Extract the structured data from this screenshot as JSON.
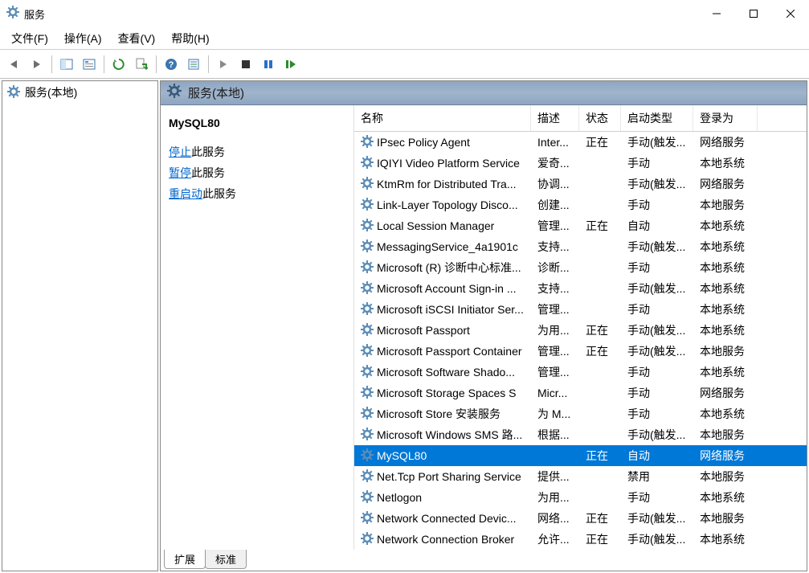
{
  "window": {
    "title": "服务"
  },
  "menu": {
    "file": "文件(F)",
    "action": "操作(A)",
    "view": "查看(V)",
    "help": "帮助(H)"
  },
  "tree": {
    "root": "服务(本地)"
  },
  "pane_header": "服务(本地)",
  "detail": {
    "selected_name": "MySQL80",
    "stop": {
      "link": "停止",
      "suffix": "此服务"
    },
    "pause": {
      "link": "暂停",
      "suffix": "此服务"
    },
    "restart": {
      "link": "重启动",
      "suffix": "此服务"
    }
  },
  "columns": {
    "name": "名称",
    "desc": "描述",
    "status": "状态",
    "startup": "启动类型",
    "logon": "登录为"
  },
  "services": [
    {
      "name": "IPsec Policy Agent",
      "desc": "Inter...",
      "status": "正在",
      "startup": "手动(触发...",
      "logon": "网络服务"
    },
    {
      "name": "IQIYI Video Platform Service",
      "desc": "爱奇...",
      "status": "",
      "startup": "手动",
      "logon": "本地系统"
    },
    {
      "name": "KtmRm for Distributed Tra...",
      "desc": "协调...",
      "status": "",
      "startup": "手动(触发...",
      "logon": "网络服务"
    },
    {
      "name": "Link-Layer Topology Disco...",
      "desc": "创建...",
      "status": "",
      "startup": "手动",
      "logon": "本地服务"
    },
    {
      "name": "Local Session Manager",
      "desc": "管理...",
      "status": "正在",
      "startup": "自动",
      "logon": "本地系统"
    },
    {
      "name": "MessagingService_4a1901c",
      "desc": "支持...",
      "status": "",
      "startup": "手动(触发...",
      "logon": "本地系统"
    },
    {
      "name": "Microsoft (R) 诊断中心标准...",
      "desc": "诊断...",
      "status": "",
      "startup": "手动",
      "logon": "本地系统"
    },
    {
      "name": "Microsoft Account Sign-in ...",
      "desc": "支持...",
      "status": "",
      "startup": "手动(触发...",
      "logon": "本地系统"
    },
    {
      "name": "Microsoft iSCSI Initiator Ser...",
      "desc": "管理...",
      "status": "",
      "startup": "手动",
      "logon": "本地系统"
    },
    {
      "name": "Microsoft Passport",
      "desc": "为用...",
      "status": "正在",
      "startup": "手动(触发...",
      "logon": "本地系统"
    },
    {
      "name": "Microsoft Passport Container",
      "desc": "管理...",
      "status": "正在",
      "startup": "手动(触发...",
      "logon": "本地服务"
    },
    {
      "name": "Microsoft Software Shado...",
      "desc": "管理...",
      "status": "",
      "startup": "手动",
      "logon": "本地系统"
    },
    {
      "name": "Microsoft Storage Spaces S",
      "desc": "Micr...",
      "status": "",
      "startup": "手动",
      "logon": "网络服务"
    },
    {
      "name": "Microsoft Store 安装服务",
      "desc": "为 M...",
      "status": "",
      "startup": "手动",
      "logon": "本地系统"
    },
    {
      "name": "Microsoft Windows SMS 路...",
      "desc": "根据...",
      "status": "",
      "startup": "手动(触发...",
      "logon": "本地服务"
    },
    {
      "name": "MySQL80",
      "desc": "",
      "status": "正在",
      "startup": "自动",
      "logon": "网络服务"
    },
    {
      "name": "Net.Tcp Port Sharing Service",
      "desc": "提供...",
      "status": "",
      "startup": "禁用",
      "logon": "本地服务"
    },
    {
      "name": "Netlogon",
      "desc": "为用...",
      "status": "",
      "startup": "手动",
      "logon": "本地系统"
    },
    {
      "name": "Network Connected Devic...",
      "desc": "网络...",
      "status": "正在",
      "startup": "手动(触发...",
      "logon": "本地服务"
    },
    {
      "name": "Network Connection Broker",
      "desc": "允许...",
      "status": "正在",
      "startup": "手动(触发...",
      "logon": "本地系统"
    }
  ],
  "selected_index": 15,
  "tabs": {
    "extended": "扩展",
    "standard": "标准"
  }
}
